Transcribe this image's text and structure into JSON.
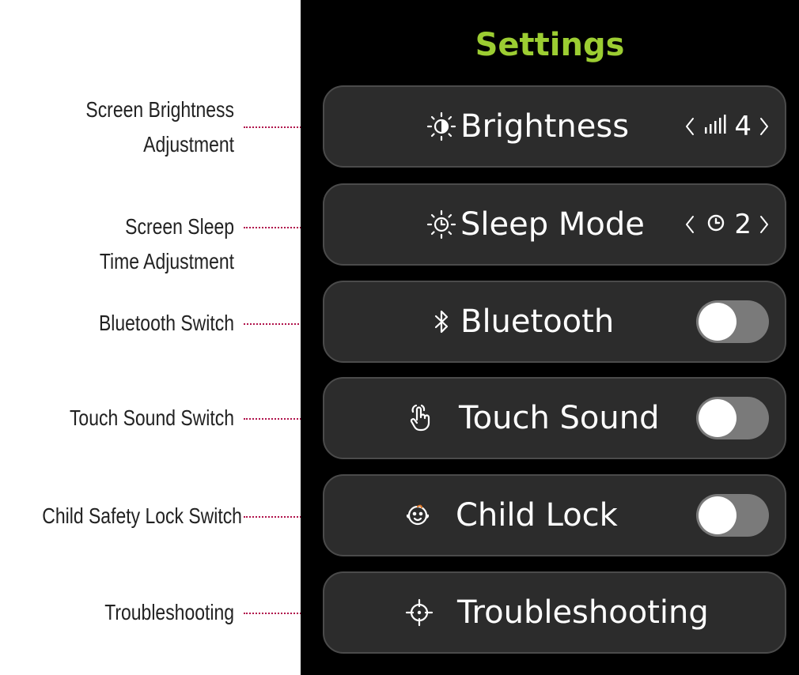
{
  "annotations": [
    {
      "lines": [
        "Screen Brightness",
        "Adjustment"
      ]
    },
    {
      "lines": [
        "Screen Sleep",
        "Time Adjustment"
      ]
    },
    {
      "lines": [
        "Bluetooth Switch"
      ]
    },
    {
      "lines": [
        "Touch Sound Switch"
      ]
    },
    {
      "lines": [
        "Child Safety Lock Switch"
      ]
    },
    {
      "lines": [
        "Troubleshooting"
      ]
    }
  ],
  "colors": {
    "title": "#9ccd32",
    "leader": "#b0134b",
    "row_bg": "#2c2c2c",
    "toggle_off": "#7a7a7a"
  },
  "screen": {
    "title": "Settings",
    "rows": [
      {
        "icon": "brightness-icon",
        "label": "Brightness",
        "control": "stepper",
        "value": "4",
        "value_icon": "signal-bars-icon"
      },
      {
        "icon": "sleep-timer-icon",
        "label": "Sleep Mode",
        "control": "stepper",
        "value": "2",
        "value_icon": "clock-icon"
      },
      {
        "icon": "bluetooth-icon",
        "label": "Bluetooth",
        "control": "toggle",
        "state": "off"
      },
      {
        "icon": "touch-hand-icon",
        "label": "Touch Sound",
        "control": "toggle",
        "state": "off"
      },
      {
        "icon": "child-face-icon",
        "label": "Child Lock",
        "control": "toggle",
        "state": "off"
      },
      {
        "icon": "crosshair-icon",
        "label": "Troubleshooting",
        "control": "none"
      }
    ]
  }
}
